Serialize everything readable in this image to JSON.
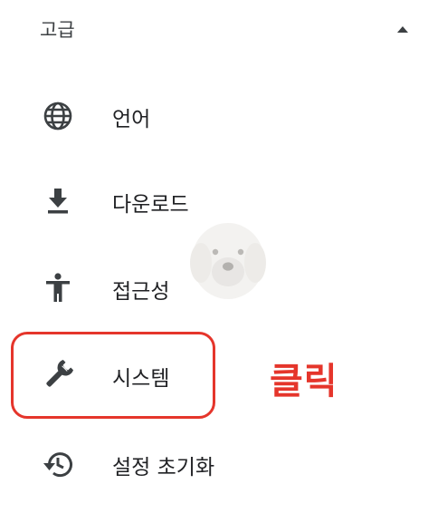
{
  "section": {
    "title": "고급",
    "collapse_icon": "arrow-drop-up-icon"
  },
  "items": [
    {
      "label": "언어",
      "icon": "language-globe-icon"
    },
    {
      "label": "다운로드",
      "icon": "download-icon"
    },
    {
      "label": "접근성",
      "icon": "accessibility-icon"
    },
    {
      "label": "시스템",
      "icon": "wrench-icon"
    },
    {
      "label": "설정 초기화",
      "icon": "reset-history-icon"
    }
  ],
  "annotation": {
    "text": "클릭",
    "color": "#e5352b"
  }
}
